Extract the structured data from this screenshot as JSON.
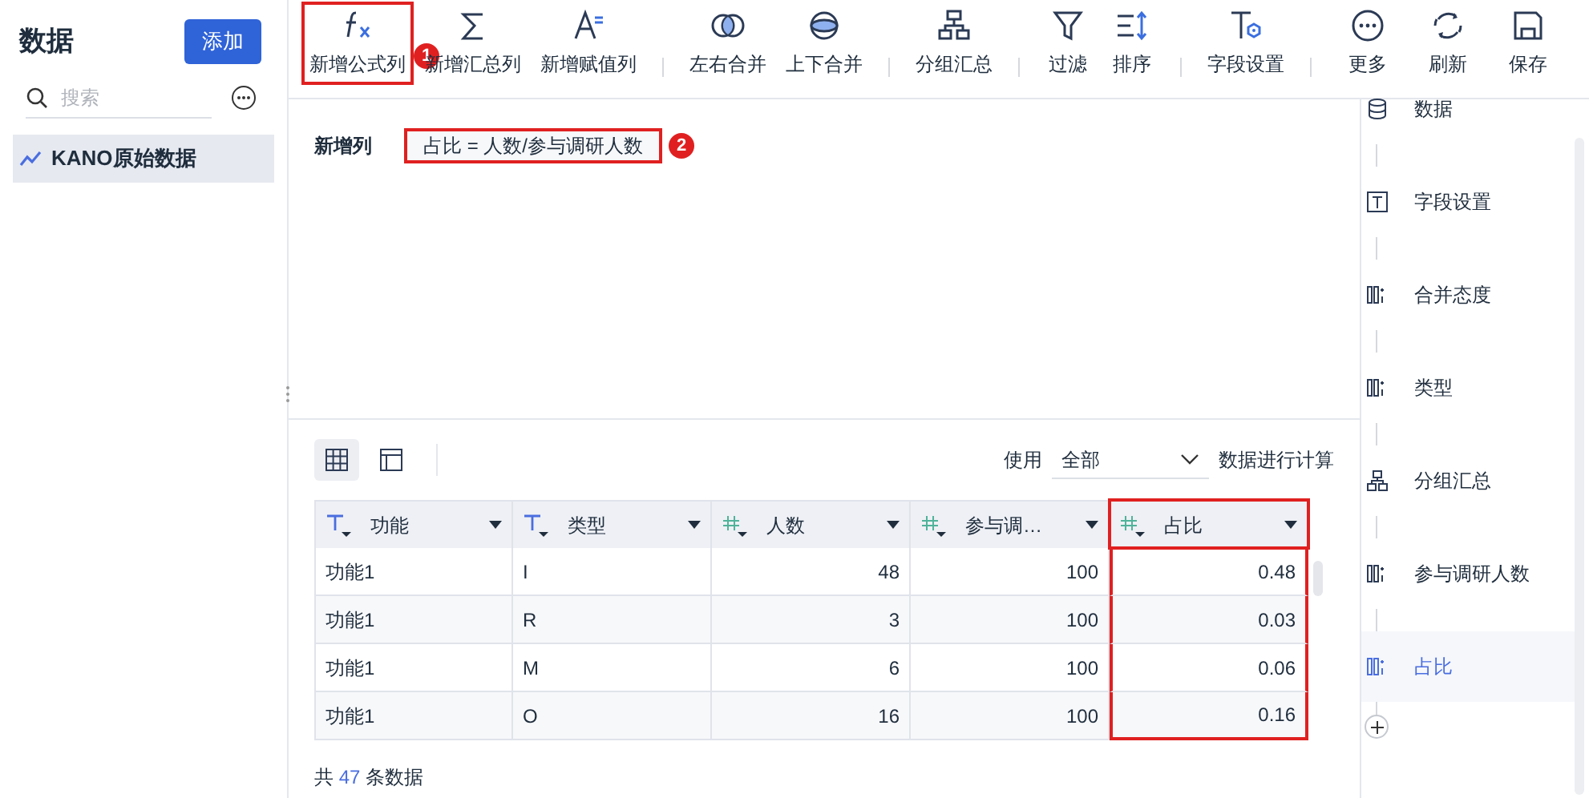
{
  "sidebar": {
    "title": "数据",
    "add_button": "添加",
    "search": {
      "placeholder": "搜索"
    },
    "items": [
      {
        "label": "KANO原始数据",
        "selected": true
      }
    ]
  },
  "toolbar": [
    {
      "kind": "button",
      "label": "新增公式列",
      "highlighted": true,
      "badge": "1"
    },
    {
      "kind": "button",
      "label": "新增汇总列",
      "highlighted": false
    },
    {
      "kind": "button",
      "label": "新增赋值列",
      "highlighted": false
    },
    {
      "kind": "separator"
    },
    {
      "kind": "button",
      "label": "左右合并",
      "highlighted": false
    },
    {
      "kind": "button",
      "label": "上下合并",
      "highlighted": false
    },
    {
      "kind": "separator"
    },
    {
      "kind": "button",
      "label": "分组汇总",
      "highlighted": false
    },
    {
      "kind": "separator"
    },
    {
      "kind": "button",
      "label": "过滤",
      "highlighted": false
    },
    {
      "kind": "button",
      "label": "排序",
      "highlighted": false
    },
    {
      "kind": "separator"
    },
    {
      "kind": "button",
      "label": "字段设置",
      "highlighted": false
    },
    {
      "kind": "separator"
    },
    {
      "kind": "button",
      "label": "更多",
      "highlighted": false
    },
    {
      "kind": "button",
      "label": "刷新",
      "highlighted": false
    },
    {
      "kind": "button",
      "label": "保存",
      "highlighted": false
    }
  ],
  "formula": {
    "label": "新增列",
    "value": "占比 = 人数/参与调研人数",
    "highlighted": true,
    "badge": "2"
  },
  "view_toggle": [
    {
      "selected": true
    },
    {
      "selected": false
    }
  ],
  "scope": {
    "prefix": "使用",
    "value": "全部",
    "suffix": "数据进行计算"
  },
  "table": {
    "columns": [
      {
        "label": "功能",
        "kind": "text",
        "highlighted": false
      },
      {
        "label": "类型",
        "kind": "text",
        "highlighted": false
      },
      {
        "label": "人数",
        "kind": "number",
        "highlighted": false
      },
      {
        "label": "参与调…",
        "kind": "number",
        "highlighted": false
      },
      {
        "label": "占比",
        "kind": "number",
        "highlighted": true
      }
    ],
    "rows": [
      [
        "功能1",
        "I",
        "48",
        "100",
        "0.48"
      ],
      [
        "功能1",
        "R",
        "3",
        "100",
        "0.03"
      ],
      [
        "功能1",
        "M",
        "6",
        "100",
        "0.06"
      ],
      [
        "功能1",
        "O",
        "16",
        "100",
        "0.16"
      ]
    ]
  },
  "footer": {
    "prefix": "共",
    "count": "47",
    "suffix": "条数据"
  },
  "steps": [
    {
      "kind": "database",
      "label": "数据",
      "selected": false
    },
    {
      "kind": "text-field",
      "label": "字段设置",
      "selected": false
    },
    {
      "kind": "columns",
      "label": "合并态度",
      "selected": false
    },
    {
      "kind": "columns",
      "label": "类型",
      "selected": false
    },
    {
      "kind": "group",
      "label": "分组汇总",
      "selected": false
    },
    {
      "kind": "columns",
      "label": "参与调研人数",
      "selected": false
    },
    {
      "kind": "columns",
      "label": "占比",
      "selected": true
    }
  ]
}
